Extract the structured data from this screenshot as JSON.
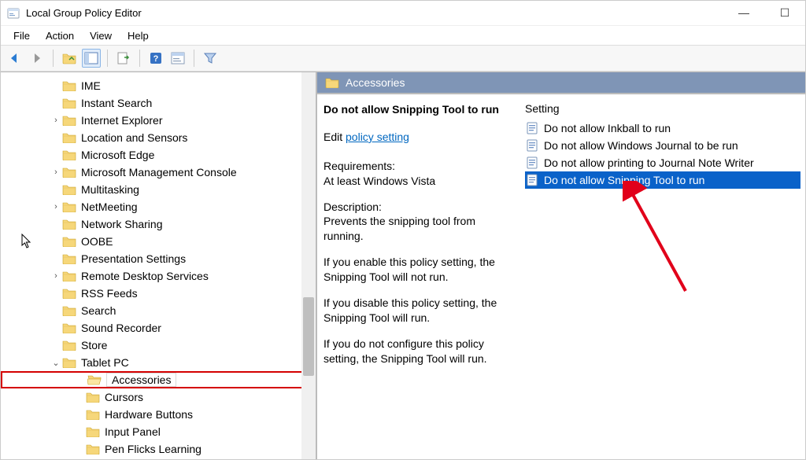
{
  "window": {
    "title": "Local Group Policy Editor"
  },
  "menubar": {
    "file": "File",
    "action": "Action",
    "view": "View",
    "help": "Help"
  },
  "tree": {
    "items": [
      {
        "label": "IME",
        "depth": 0,
        "expander": ""
      },
      {
        "label": "Instant Search",
        "depth": 0,
        "expander": ""
      },
      {
        "label": "Internet Explorer",
        "depth": 0,
        "expander": "›"
      },
      {
        "label": "Location and Sensors",
        "depth": 0,
        "expander": ""
      },
      {
        "label": "Microsoft Edge",
        "depth": 0,
        "expander": ""
      },
      {
        "label": "Microsoft Management Console",
        "depth": 0,
        "expander": "›"
      },
      {
        "label": "Multitasking",
        "depth": 0,
        "expander": ""
      },
      {
        "label": "NetMeeting",
        "depth": 0,
        "expander": "›"
      },
      {
        "label": "Network Sharing",
        "depth": 0,
        "expander": ""
      },
      {
        "label": "OOBE",
        "depth": 0,
        "expander": ""
      },
      {
        "label": "Presentation Settings",
        "depth": 0,
        "expander": ""
      },
      {
        "label": "Remote Desktop Services",
        "depth": 0,
        "expander": "›"
      },
      {
        "label": "RSS Feeds",
        "depth": 0,
        "expander": ""
      },
      {
        "label": "Search",
        "depth": 0,
        "expander": ""
      },
      {
        "label": "Sound Recorder",
        "depth": 0,
        "expander": ""
      },
      {
        "label": "Store",
        "depth": 0,
        "expander": ""
      },
      {
        "label": "Tablet PC",
        "depth": 0,
        "expander": "⌄"
      },
      {
        "label": "Accessories",
        "depth": 1,
        "expander": "",
        "highlight": true
      },
      {
        "label": "Cursors",
        "depth": 1,
        "expander": ""
      },
      {
        "label": "Hardware Buttons",
        "depth": 1,
        "expander": ""
      },
      {
        "label": "Input Panel",
        "depth": 1,
        "expander": ""
      },
      {
        "label": "Pen Flicks Learning",
        "depth": 1,
        "expander": ""
      }
    ]
  },
  "rightHeader": {
    "label": "Accessories"
  },
  "detail": {
    "title": "Do not allow Snipping Tool to run",
    "edit_prefix": "Edit ",
    "edit_link": "policy setting",
    "req_label": "Requirements:",
    "req_value": "At least Windows Vista",
    "desc_label": "Description:",
    "desc_value": "Prevents the snipping tool from running.",
    "p1": "If you enable this policy setting, the Snipping Tool will not run.",
    "p2": "If you disable this policy setting, the Snipping Tool will run.",
    "p3": "If you do not configure this policy setting, the Snipping Tool will run."
  },
  "settings": {
    "header": "Setting",
    "rows": [
      {
        "label": "Do not allow Inkball to run",
        "selected": false
      },
      {
        "label": "Do not allow Windows Journal to be run",
        "selected": false
      },
      {
        "label": "Do not allow printing to Journal Note Writer",
        "selected": false
      },
      {
        "label": "Do not allow Snipping Tool to run",
        "selected": true
      }
    ]
  }
}
